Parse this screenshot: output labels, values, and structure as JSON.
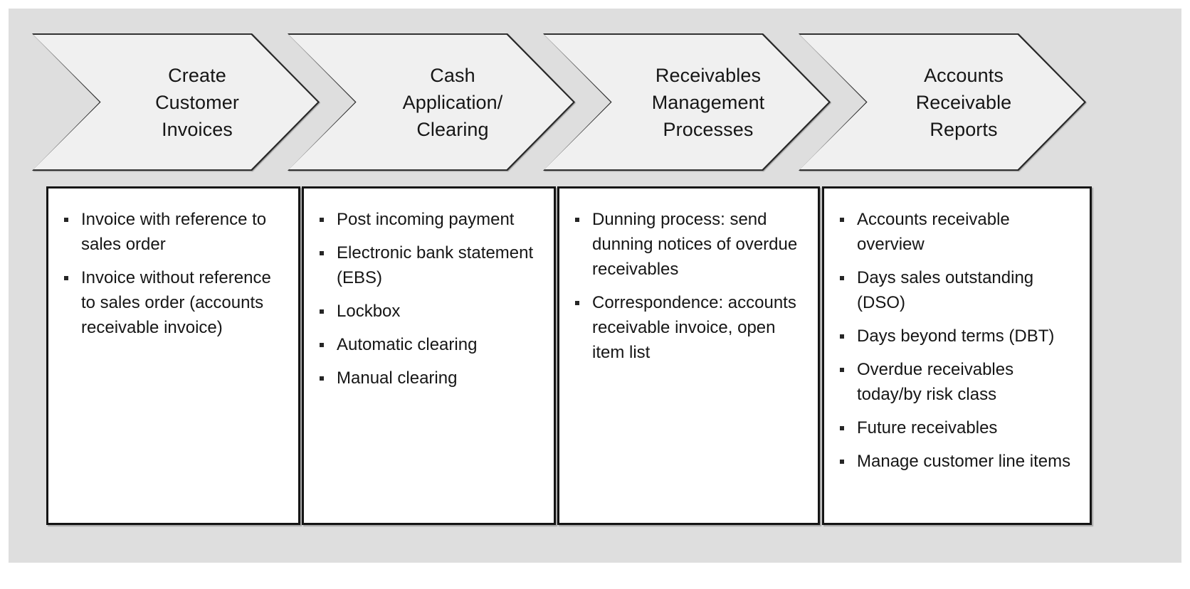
{
  "diagram": {
    "type": "process-flow-chevron",
    "background_color": "#dedede",
    "chevron_fill": "#f0f0f0",
    "chevron_border": "#262626",
    "box_fill": "#ffffff",
    "box_border": "#151515",
    "text_color": "#161616",
    "bullet_glyph": "square-bullet"
  },
  "columns": [
    {
      "id": "create-customer-invoices",
      "header": "Create\nCustomer\nInvoices",
      "items": [
        "Invoice with reference to sales order",
        "Invoice without reference to sales order (accounts receivable invoice)"
      ]
    },
    {
      "id": "cash-application-clearing",
      "header": "Cash\nApplication/\nClearing",
      "items": [
        "Post incoming payment",
        "Electronic bank statement (EBS)",
        "Lockbox",
        "Automatic clearing",
        "Manual clearing"
      ]
    },
    {
      "id": "receivables-management-processes",
      "header": "Receivables\nManagement\nProcesses",
      "items": [
        "Dunning process: send dunning notices of overdue receivables",
        "Correspondence: accounts receivable invoice, open item list"
      ]
    },
    {
      "id": "accounts-receivable-reports",
      "header": "Accounts\nReceivable\nReports",
      "items": [
        "Accounts receivable overview",
        "Days sales outstanding (DSO)",
        "Days beyond terms (DBT)",
        "Overdue receivables today/by risk class",
        "Future receivables",
        "Manage customer line items"
      ]
    }
  ]
}
